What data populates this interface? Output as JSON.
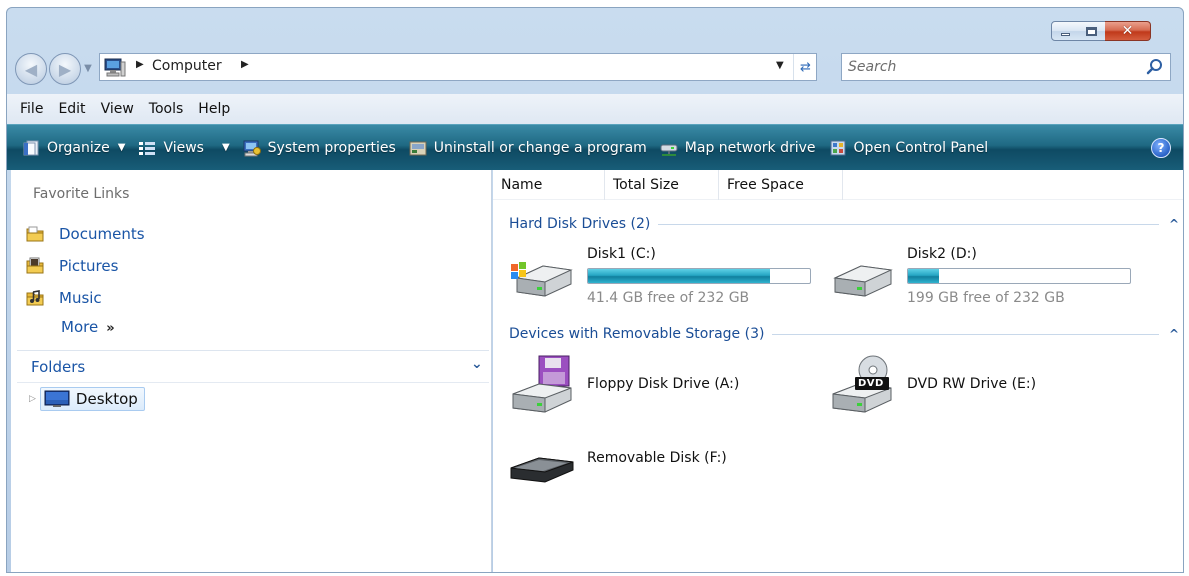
{
  "window": {
    "caption_buttons": {
      "minimize": "minimize",
      "maximize": "maximize",
      "close": "✕"
    }
  },
  "address_bar": {
    "breadcrumb": [
      "Computer"
    ],
    "search_placeholder": "Search"
  },
  "menu_bar": {
    "items": [
      "File",
      "Edit",
      "View",
      "Tools",
      "Help"
    ]
  },
  "command_bar": {
    "organize": "Organize",
    "views": "Views",
    "system_properties": "System properties",
    "uninstall": "Uninstall or change a program",
    "map_network_drive": "Map network drive",
    "open_control_panel": "Open Control Panel",
    "help": "?"
  },
  "navigation_pane": {
    "favorite_links_heading": "Favorite Links",
    "favorite_links": [
      {
        "label": "Documents",
        "icon": "documents-folder-icon"
      },
      {
        "label": "Pictures",
        "icon": "pictures-folder-icon"
      },
      {
        "label": "Music",
        "icon": "music-folder-icon"
      }
    ],
    "more_label": "More",
    "more_chevron": "»",
    "folders_heading": "Folders",
    "folders_collapse": "⌄",
    "tree": [
      {
        "label": "Desktop",
        "icon": "desktop-icon",
        "expand": "▷"
      }
    ]
  },
  "content_pane": {
    "columns": [
      "Name",
      "Total Size",
      "Free Space"
    ],
    "groups": [
      {
        "label": "Hard Disk Drives (2)",
        "items": [
          {
            "name": "Disk1 (C:)",
            "space_text": "41.4 GB free of 232 GB",
            "used_fraction": 0.82,
            "icon": "windows-hard-drive-icon"
          },
          {
            "name": "Disk2 (D:)",
            "space_text": "199 GB free of 232 GB",
            "used_fraction": 0.14,
            "icon": "hard-drive-icon"
          }
        ]
      },
      {
        "label": "Devices with Removable Storage (3)",
        "items": [
          {
            "name": "Floppy Disk Drive (A:)",
            "icon": "floppy-drive-icon"
          },
          {
            "name": "DVD RW Drive (E:)",
            "icon": "dvd-drive-icon",
            "badge": "DVD"
          },
          {
            "name": "Removable Disk (F:)",
            "icon": "removable-disk-icon"
          }
        ]
      }
    ],
    "group_collapse_glyph": "^"
  },
  "colors": {
    "command_bar": "#1f6983",
    "link_blue": "#1a55a6",
    "group_header_blue": "#1a4d96",
    "drive_bar_fill": "#26a6c4"
  }
}
